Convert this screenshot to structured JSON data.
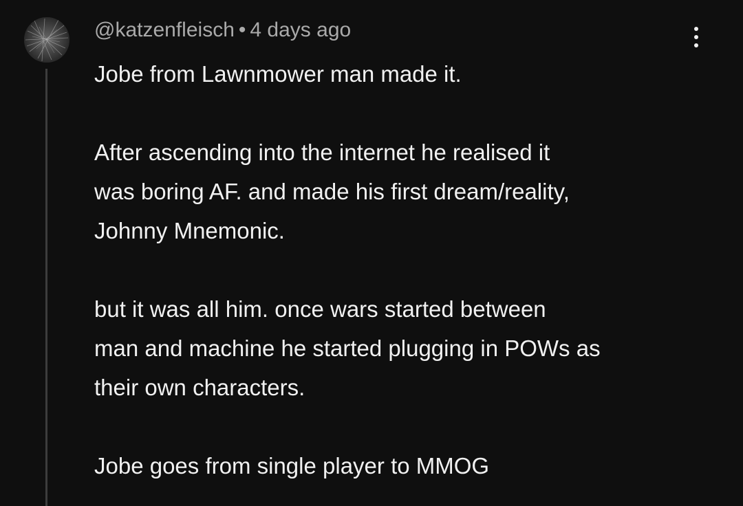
{
  "comment": {
    "author": "@katzenfleisch",
    "separator": "•",
    "timestamp": "4 days ago",
    "menu_icon": "more-vertical-icon",
    "avatar_icon": "avatar-image",
    "paragraphs": [
      [
        "Jobe from Lawnmower man made it."
      ],
      [
        "After ascending into the internet he realised it",
        "was boring AF. and made his first dream/reality,",
        "Johnny Mnemonic."
      ],
      [
        "but it was all him. once wars started between",
        "man and machine he started plugging in POWs as",
        "their own characters."
      ],
      [
        "Jobe goes from single player to MMOG"
      ]
    ]
  },
  "colors": {
    "background": "#0f0f0f",
    "text": "#f1f1f1",
    "secondary_text": "#aaaaaa",
    "thread_line": "#3d3d3d"
  }
}
